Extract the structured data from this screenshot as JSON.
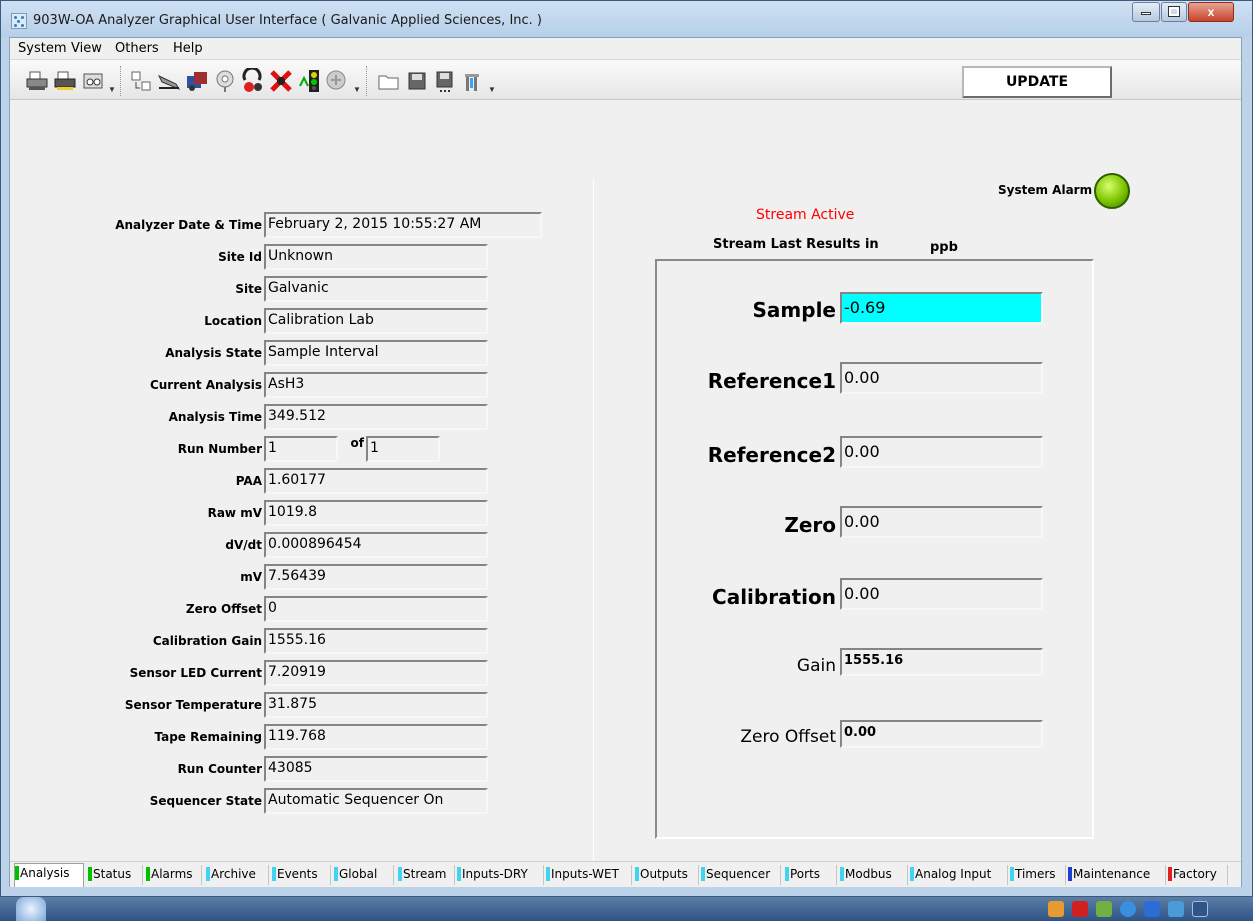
{
  "window": {
    "title": "903W-OA Analyzer Graphical User Interface  ( Galvanic Applied Sciences, Inc. )",
    "minimize_label": "",
    "maximize_label": "",
    "close_label": "x"
  },
  "menu": [
    "System",
    "View",
    "Others",
    "Help"
  ],
  "toolbar": {
    "update_label": "UPDATE",
    "icons": [
      "printer-icon",
      "printer-setup-icon",
      "print-preview-icon",
      "data-transfer-icon",
      "tape-advance-icon",
      "sequencer-icon",
      "settings-wheel-icon",
      "run-stop-icon",
      "abort-icon",
      "traffic-light-icon",
      "diagnostics-icon",
      "open-folder-icon",
      "save-icon",
      "save-as-icon",
      "exit-icon"
    ]
  },
  "alarm": {
    "label": "System Alarm",
    "status_color": "#7cc400"
  },
  "left_panel": {
    "fields": [
      {
        "label": "Analyzer Date & Time",
        "value": "February 2, 2015 10:55:27 AM"
      },
      {
        "label": "Site Id",
        "value": "Unknown"
      },
      {
        "label": "Site",
        "value": "Galvanic"
      },
      {
        "label": "Location",
        "value": "Calibration Lab"
      },
      {
        "label": "Analysis State",
        "value": "Sample Interval"
      },
      {
        "label": "Current Analysis",
        "value": "AsH3"
      },
      {
        "label": "Analysis Time",
        "value": "349.512"
      },
      {
        "label": "Run Number",
        "value": "1"
      },
      {
        "label": "PAA",
        "value": "1.60177"
      },
      {
        "label": "Raw mV",
        "value": "1019.8"
      },
      {
        "label": "dV/dt",
        "value": "0.000896454"
      },
      {
        "label": "mV",
        "value": "7.56439"
      },
      {
        "label": "Zero Offset",
        "value": "0"
      },
      {
        "label": "Calibration Gain",
        "value": "1555.16"
      },
      {
        "label": "Sensor LED Current",
        "value": "7.20919"
      },
      {
        "label": "Sensor Temperature",
        "value": "31.875"
      },
      {
        "label": "Tape Remaining",
        "value": "119.768"
      },
      {
        "label": "Run Counter",
        "value": "43085"
      },
      {
        "label": "Sequencer State",
        "value": "Automatic Sequencer On"
      }
    ],
    "run_of_label": "of",
    "run_of_value": "1"
  },
  "right_panel": {
    "stream_status": "Stream Active",
    "results_title": "Stream Last Results in",
    "units": "ppb",
    "results": [
      {
        "label": "Sample",
        "value": "-0.69",
        "highlight": "#00ffff"
      },
      {
        "label": "Reference1",
        "value": "0.00"
      },
      {
        "label": "Reference2",
        "value": "0.00"
      },
      {
        "label": "Zero",
        "value": "0.00"
      },
      {
        "label": "Calibration",
        "value": "0.00"
      },
      {
        "label": "Gain",
        "value": "1555.16"
      },
      {
        "label": "Zero Offset",
        "value": "0.00"
      }
    ]
  },
  "tabs": [
    {
      "label": "Analysis",
      "color": "#00c000",
      "active": true
    },
    {
      "label": "Status",
      "color": "#00c000"
    },
    {
      "label": "Alarms",
      "color": "#00c000"
    },
    {
      "label": "Archive",
      "color": "#3fd4f0"
    },
    {
      "label": "Events",
      "color": "#3fd4f0"
    },
    {
      "label": "Global",
      "color": "#3fd4f0"
    },
    {
      "label": "Stream",
      "color": "#3fd4f0"
    },
    {
      "label": "Inputs-DRY",
      "color": "#3fd4f0"
    },
    {
      "label": "Inputs-WET",
      "color": "#3fd4f0"
    },
    {
      "label": "Outputs",
      "color": "#3fd4f0"
    },
    {
      "label": "Sequencer",
      "color": "#3fd4f0"
    },
    {
      "label": "Ports",
      "color": "#3fd4f0"
    },
    {
      "label": "Modbus",
      "color": "#3fd4f0"
    },
    {
      "label": "Analog Input",
      "color": "#3fd4f0"
    },
    {
      "label": "Timers",
      "color": "#3fd4f0"
    },
    {
      "label": "Maintenance",
      "color": "#1f3fd0"
    },
    {
      "label": "Factory",
      "color": "#e02020"
    }
  ]
}
